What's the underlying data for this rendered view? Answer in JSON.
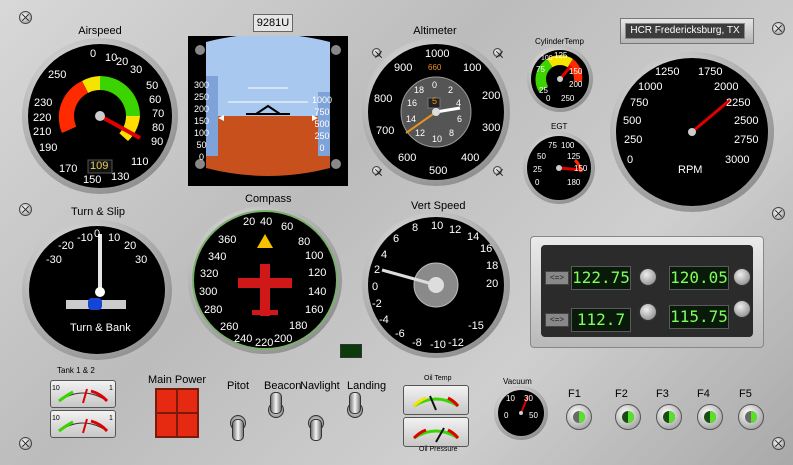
{
  "tail_number": "9281U",
  "location": "HCR Fredericksburg, TX",
  "airspeed": {
    "title": "Airspeed",
    "ticks": [
      "0",
      "10",
      "20",
      "30",
      "50",
      "60",
      "70",
      "80",
      "90",
      "110",
      "130",
      "150",
      "170",
      "190",
      "210",
      "220",
      "230",
      "250"
    ],
    "value_display": "109"
  },
  "attitude": {
    "left_scale": [
      "300",
      "250",
      "200",
      "150",
      "100",
      "50",
      "0"
    ],
    "right_scale": [
      "1000",
      "750",
      "500",
      "250",
      "0"
    ]
  },
  "altimeter": {
    "title": "Altimeter",
    "ticks": [
      "1000",
      "900",
      "800",
      "700",
      "600",
      "500",
      "400",
      "300",
      "200",
      "100"
    ],
    "inner_ticks": [
      "0",
      "2",
      "4",
      "6",
      "8",
      "10",
      "12",
      "14",
      "16",
      "18",
      "20"
    ],
    "top_value": "660",
    "window": "5"
  },
  "cylinder_temp": {
    "title": "CylinderTemp",
    "ticks": [
      "75",
      "100",
      "125",
      "150",
      "200",
      "250",
      "25",
      "0"
    ]
  },
  "egt": {
    "title": "EGT",
    "ticks": [
      "75",
      "100",
      "50",
      "125",
      "25",
      "150",
      "0",
      "180"
    ]
  },
  "rpm": {
    "title": "RPM",
    "ticks": [
      "1250",
      "1750",
      "1000",
      "2000",
      "750",
      "2250",
      "500",
      "2500",
      "250",
      "2750",
      "0",
      "3000"
    ]
  },
  "turn_slip": {
    "title": "Turn & Slip",
    "ticks": [
      "-20",
      "-10",
      "0",
      "10",
      "20",
      "-30",
      "30"
    ],
    "caption": "Turn & Bank"
  },
  "compass": {
    "title": "Compass",
    "ticks": [
      "20",
      "40",
      "60",
      "360",
      "80",
      "340",
      "100",
      "320",
      "120",
      "300",
      "140",
      "280",
      "160",
      "260",
      "180",
      "240",
      "200",
      "220"
    ]
  },
  "vert_speed": {
    "title": "Vert Speed",
    "ticks": [
      "8",
      "10",
      "12",
      "14",
      "6",
      "16",
      "4",
      "18",
      "2",
      "20",
      "0",
      "-2",
      "-4",
      "-6",
      "-8",
      "-10",
      "-12",
      "-15"
    ]
  },
  "radios": {
    "com_active": "122.75",
    "com_standby": "120.05",
    "nav_active": "112.7",
    "nav_standby": "115.75",
    "swap_label": "<=>"
  },
  "tank": {
    "title": "Tank 1 & 2",
    "low": "10",
    "high": "1"
  },
  "main_power": {
    "title": "Main Power"
  },
  "switches": {
    "pitot": "Pitot",
    "beacon": "Beacon",
    "navlight": "Navlight",
    "landing": "Landing"
  },
  "oil_temp": {
    "title": "Oil Temp"
  },
  "oil_pressure": {
    "title": "Oil Pressure"
  },
  "vacuum": {
    "title": "Vacuum",
    "ticks": [
      "10",
      "30",
      "0",
      "50"
    ]
  },
  "function_keys": [
    "F1",
    "F2",
    "F3",
    "F4",
    "F5"
  ],
  "colors": {
    "lcd_text": "#7dff5a",
    "sky": "#a8c8f0",
    "ground": "#c8501c",
    "arc_green": "#3cd400",
    "arc_red": "#ff2a00",
    "arc_yellow": "#f4e400",
    "needle": "#d8d8d8",
    "red_needle": "#e00000",
    "power_red": "#e62a12"
  }
}
